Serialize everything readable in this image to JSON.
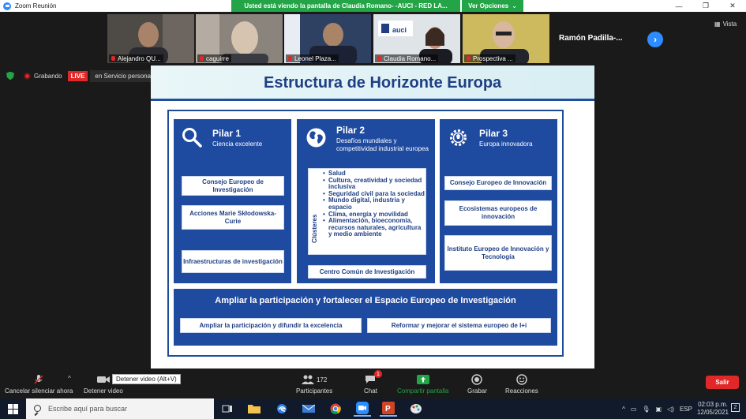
{
  "window": {
    "title": "Zoom Reunión",
    "share_banner": "Usted está viendo la pantalla de Claudia Romano- -AUCI - RED LA...",
    "view_options": "Ver Opciones",
    "controls": [
      "—",
      "❐",
      "✕"
    ]
  },
  "participants": [
    {
      "name": "Alejandro QU...",
      "bg": "#5f5a55",
      "face": "#b08a70"
    },
    {
      "name": "caguirre",
      "bg": "#7c7770",
      "face": "#d8c8b8"
    },
    {
      "name": "Leonel Plaza...",
      "bg": "#3b4a6a",
      "face": "#b58d6c"
    },
    {
      "name": "Claudia Romano...",
      "bg": "#cfd6dc",
      "face": "#c09078"
    },
    {
      "name": "Prospectiva ...",
      "bg": "#c9b65c",
      "face": "#d8b49c"
    }
  ],
  "extra_participant": "Ramón  Padilla-...",
  "view_label": "Vista",
  "recording": {
    "label": "Grabando",
    "live": "LIVE",
    "stream": "en Servicio personalizado de transmisión en vivo"
  },
  "slide": {
    "title": "Estructura de Horizonte Europa",
    "pillar1": {
      "title": "Pilar 1",
      "subtitle": "Ciencia excelente",
      "boxes": [
        "Consejo Europeo de Investigación",
        "Acciones Marie Skłodowska-Curie",
        "Infraestructuras de investigación"
      ]
    },
    "pillar2": {
      "title": "Pilar 2",
      "subtitle": "Desafíos mundiales y competitividad industrial europea",
      "clusters_label": "Clústeres",
      "clusters": [
        "Salud",
        "Cultura, creatividad y sociedad inclusiva",
        "Seguridad civil para la sociedad",
        "Mundo digital, industria y espacio",
        "Clima, energía y movilidad",
        "Alimentación, bioeconomía, recursos naturales, agricultura y medio ambiente"
      ],
      "box": "Centro Común de Investigación"
    },
    "pillar3": {
      "title": "Pilar 3",
      "subtitle": "Europa innovadora",
      "boxes": [
        "Consejo Europeo de Innovación",
        "Ecosistemas europeos de innovación",
        "Instituto Europeo de Innovación y Tecnología"
      ]
    },
    "band": {
      "title": "Ampliar la participación y fortalecer el Espacio Europeo de Investigación",
      "left": "Ampliar la participación y difundir la excelencia",
      "right": "Reformar y mejorar el sistema europeo de I+i"
    }
  },
  "toolbar": {
    "mute": "Cancelar silenciar ahora",
    "video": "Detener video",
    "tooltip": "Detener video (Alt+V)",
    "participants": "Participantes",
    "participants_count": "172",
    "chat": "Chat",
    "chat_badge": "1",
    "share": "Compartir pantalla",
    "record": "Grabar",
    "reactions": "Reacciones",
    "leave": "Salir"
  },
  "taskbar": {
    "search_placeholder": "Escribe aquí para buscar",
    "language": "ESP",
    "time": "02:03 p.m.",
    "date": "12/05/2021",
    "notifications": "2"
  },
  "colors": {
    "zoom_blue": "#2d8cff",
    "share_green": "#23a447",
    "record_red": "#e02828",
    "pillar_blue": "#1e4aa0",
    "title_blue": "#1f3f84"
  }
}
